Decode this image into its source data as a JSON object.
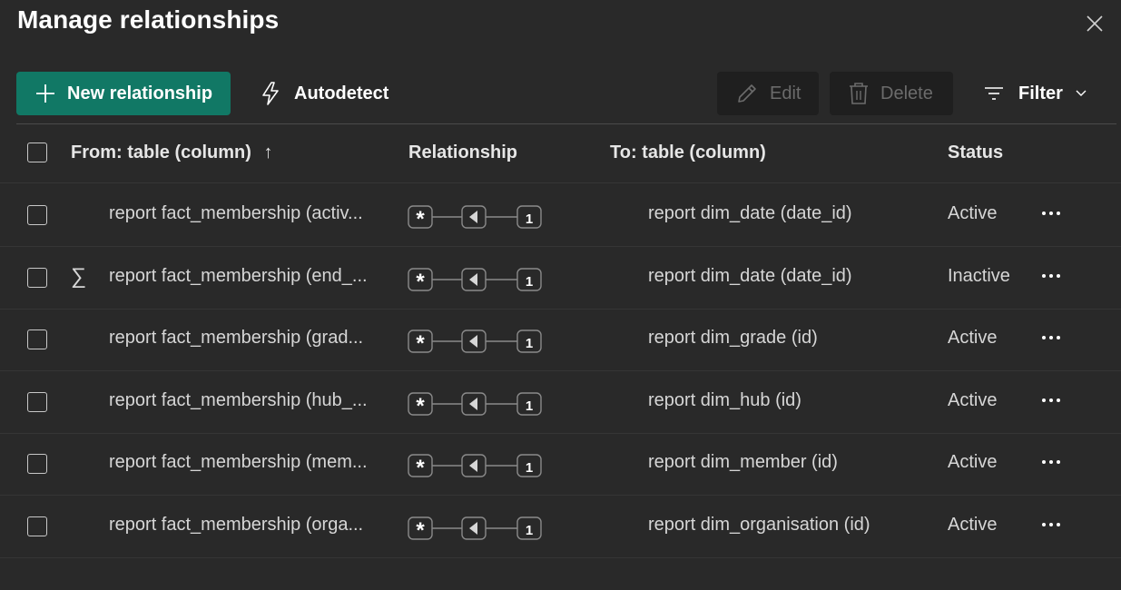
{
  "dialog": {
    "title": "Manage relationships"
  },
  "toolbar": {
    "new_label": "New relationship",
    "autodetect_label": "Autodetect",
    "edit_label": "Edit",
    "delete_label": "Delete",
    "filter_label": "Filter"
  },
  "table": {
    "headers": {
      "from": "From: table (column)",
      "relationship": "Relationship",
      "to": "To: table (column)",
      "status": "Status"
    },
    "sort_indicator": "↑",
    "rows": [
      {
        "from": "report fact_membership (activ...",
        "to": "report dim_date (date_id)",
        "status": "Active",
        "measure_icon": false,
        "cardinality_from": "*",
        "cardinality_to": "1"
      },
      {
        "from": "report fact_membership (end_...",
        "to": "report dim_date (date_id)",
        "status": "Inactive",
        "measure_icon": true,
        "cardinality_from": "*",
        "cardinality_to": "1"
      },
      {
        "from": "report fact_membership (grad...",
        "to": "report dim_grade (id)",
        "status": "Active",
        "measure_icon": false,
        "cardinality_from": "*",
        "cardinality_to": "1"
      },
      {
        "from": "report fact_membership (hub_...",
        "to": "report dim_hub (id)",
        "status": "Active",
        "measure_icon": false,
        "cardinality_from": "*",
        "cardinality_to": "1"
      },
      {
        "from": "report fact_membership (mem...",
        "to": "report dim_member (id)",
        "status": "Active",
        "measure_icon": false,
        "cardinality_from": "*",
        "cardinality_to": "1"
      },
      {
        "from": "report fact_membership (orga...",
        "to": "report dim_organisation (id)",
        "status": "Active",
        "measure_icon": false,
        "cardinality_from": "*",
        "cardinality_to": "1"
      }
    ]
  },
  "colors": {
    "background": "#292929",
    "primary": "#117865",
    "disabled_bg": "#1f1f1f",
    "disabled_text": "#6b6b6b"
  },
  "icons": {
    "close": "close-icon",
    "add": "plus-icon",
    "autodetect": "lightning-icon",
    "edit": "pencil-icon",
    "delete": "trash-icon",
    "filter": "filter-icon",
    "chevron": "chevron-down-icon",
    "sort": "sort-ascending-icon",
    "measure": "sigma-icon",
    "more": "more-options-icon",
    "relationship": "many-to-one-relationship-icon"
  }
}
